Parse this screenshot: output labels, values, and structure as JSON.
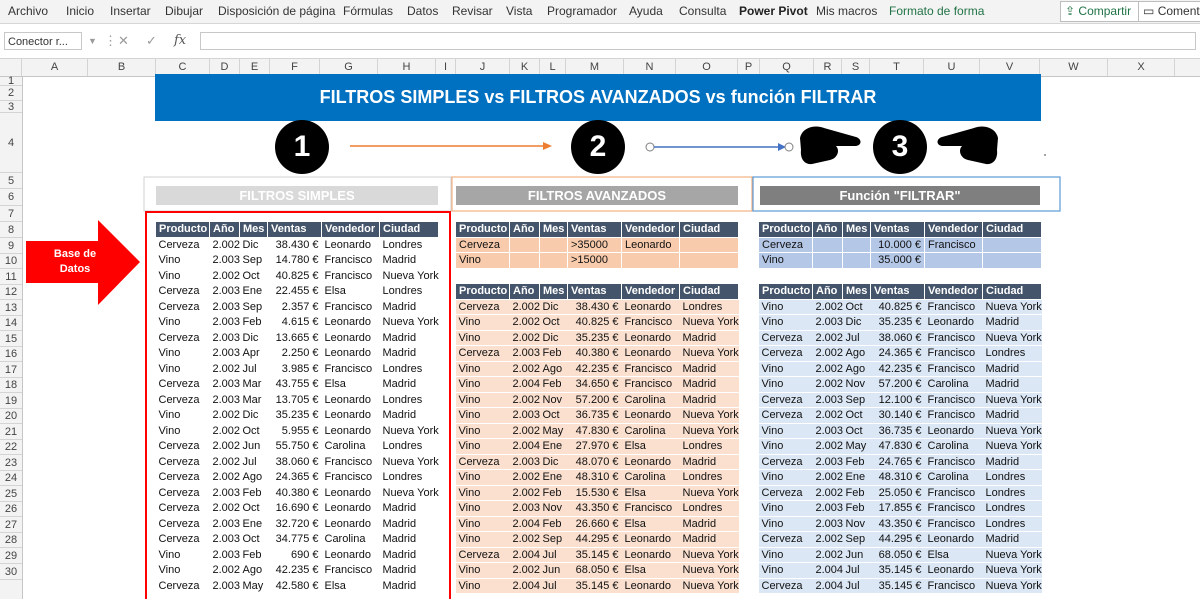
{
  "ribbon": {
    "tabs": [
      "Archivo",
      "Inicio",
      "Insertar",
      "Dibujar",
      "Disposición de página",
      "Fórmulas",
      "Datos",
      "Revisar",
      "Vista",
      "Programador",
      "Ayuda",
      "Consulta",
      "Power Pivot",
      "Mis macros",
      "Formato de forma"
    ],
    "share_label": "Compartir",
    "comments_label": "Coment"
  },
  "formula_bar": {
    "name_box": "Conector r...",
    "fx": "fx",
    "cancel": "✕",
    "enter": "✓",
    "value": ""
  },
  "columns": [
    "A",
    "B",
    "C",
    "D",
    "E",
    "F",
    "G",
    "H",
    "I",
    "J",
    "K",
    "L",
    "M",
    "N",
    "O",
    "P",
    "Q",
    "R",
    "S",
    "T",
    "U",
    "V",
    "W",
    "X"
  ],
  "rows": [
    "1",
    "2",
    "3",
    "4",
    "5",
    "6",
    "7",
    "8",
    "9",
    "10",
    "11",
    "12",
    "13",
    "14",
    "15",
    "16",
    "17",
    "18",
    "19",
    "20",
    "21",
    "22",
    "23",
    "24",
    "25",
    "26",
    "27",
    "28",
    "29",
    "30"
  ],
  "banner": "FILTROS SIMPLES vs FILTROS AVANZADOS vs función FILTRAR",
  "steps": [
    "1",
    "2",
    "3"
  ],
  "base_label": "Base de Datos",
  "sections": {
    "simple": "FILTROS SIMPLES",
    "advanced": "FILTROS AVANZADOS",
    "filtrar": "Función \"FILTRAR\""
  },
  "headers": [
    "Producto",
    "Año",
    "Mes",
    "Ventas",
    "Vendedor",
    "Ciudad"
  ],
  "table_a": [
    [
      "Cerveza",
      "2.002",
      "Dic",
      "38.430 €",
      "Leonardo",
      "Londres"
    ],
    [
      "Vino",
      "2.003",
      "Sep",
      "14.780 €",
      "Francisco",
      "Madrid"
    ],
    [
      "Vino",
      "2.002",
      "Oct",
      "40.825 €",
      "Francisco",
      "Nueva York"
    ],
    [
      "Cerveza",
      "2.003",
      "Ene",
      "22.455 €",
      "Elsa",
      "Londres"
    ],
    [
      "Cerveza",
      "2.003",
      "Sep",
      "2.357 €",
      "Francisco",
      "Madrid"
    ],
    [
      "Vino",
      "2.003",
      "Feb",
      "4.615 €",
      "Leonardo",
      "Nueva York"
    ],
    [
      "Cerveza",
      "2.003",
      "Dic",
      "13.665 €",
      "Leonardo",
      "Madrid"
    ],
    [
      "Vino",
      "2.003",
      "Apr",
      "2.250 €",
      "Leonardo",
      "Madrid"
    ],
    [
      "Vino",
      "2.002",
      "Jul",
      "3.985 €",
      "Francisco",
      "Londres"
    ],
    [
      "Cerveza",
      "2.003",
      "Mar",
      "43.755 €",
      "Elsa",
      "Madrid"
    ],
    [
      "Cerveza",
      "2.003",
      "Mar",
      "13.705 €",
      "Leonardo",
      "Londres"
    ],
    [
      "Vino",
      "2.002",
      "Dic",
      "35.235 €",
      "Leonardo",
      "Madrid"
    ],
    [
      "Vino",
      "2.002",
      "Oct",
      "5.955 €",
      "Leonardo",
      "Nueva York"
    ],
    [
      "Cerveza",
      "2.002",
      "Jun",
      "55.750 €",
      "Carolina",
      "Londres"
    ],
    [
      "Cerveza",
      "2.002",
      "Jul",
      "38.060 €",
      "Francisco",
      "Nueva York"
    ],
    [
      "Cerveza",
      "2.002",
      "Ago",
      "24.365 €",
      "Francisco",
      "Londres"
    ],
    [
      "Cerveza",
      "2.003",
      "Feb",
      "40.380 €",
      "Leonardo",
      "Nueva York"
    ],
    [
      "Cerveza",
      "2.002",
      "Oct",
      "16.690 €",
      "Leonardo",
      "Madrid"
    ],
    [
      "Cerveza",
      "2.003",
      "Ene",
      "32.720 €",
      "Leonardo",
      "Madrid"
    ],
    [
      "Cerveza",
      "2.003",
      "Oct",
      "34.775 €",
      "Carolina",
      "Madrid"
    ],
    [
      "Vino",
      "2.003",
      "Feb",
      "690 €",
      "Leonardo",
      "Madrid"
    ],
    [
      "Vino",
      "2.002",
      "Ago",
      "42.235 €",
      "Francisco",
      "Madrid"
    ],
    [
      "Cerveza",
      "2.003",
      "May",
      "42.580 €",
      "Elsa",
      "Madrid"
    ]
  ],
  "criteria_b": [
    [
      "Cerveza",
      "",
      "",
      ">35000",
      "Leonardo",
      ""
    ],
    [
      "Vino",
      "",
      "",
      ">15000",
      "",
      ""
    ]
  ],
  "table_b": [
    [
      "Cerveza",
      "2.002",
      "Dic",
      "38.430 €",
      "Leonardo",
      "Londres"
    ],
    [
      "Vino",
      "2.002",
      "Oct",
      "40.825 €",
      "Francisco",
      "Nueva York"
    ],
    [
      "Vino",
      "2.002",
      "Dic",
      "35.235 €",
      "Leonardo",
      "Madrid"
    ],
    [
      "Cerveza",
      "2.003",
      "Feb",
      "40.380 €",
      "Leonardo",
      "Nueva York"
    ],
    [
      "Vino",
      "2.002",
      "Ago",
      "42.235 €",
      "Francisco",
      "Madrid"
    ],
    [
      "Vino",
      "2.004",
      "Feb",
      "34.650 €",
      "Francisco",
      "Madrid"
    ],
    [
      "Vino",
      "2.002",
      "Nov",
      "57.200 €",
      "Carolina",
      "Madrid"
    ],
    [
      "Vino",
      "2.003",
      "Oct",
      "36.735 €",
      "Leonardo",
      "Nueva York"
    ],
    [
      "Vino",
      "2.002",
      "May",
      "47.830 €",
      "Carolina",
      "Nueva York"
    ],
    [
      "Vino",
      "2.004",
      "Ene",
      "27.970 €",
      "Elsa",
      "Londres"
    ],
    [
      "Cerveza",
      "2.003",
      "Dic",
      "48.070 €",
      "Leonardo",
      "Madrid"
    ],
    [
      "Vino",
      "2.002",
      "Ene",
      "48.310 €",
      "Carolina",
      "Londres"
    ],
    [
      "Vino",
      "2.002",
      "Feb",
      "15.530 €",
      "Elsa",
      "Nueva York"
    ],
    [
      "Vino",
      "2.003",
      "Nov",
      "43.350 €",
      "Francisco",
      "Londres"
    ],
    [
      "Vino",
      "2.004",
      "Feb",
      "26.660 €",
      "Elsa",
      "Madrid"
    ],
    [
      "Vino",
      "2.002",
      "Sep",
      "44.295 €",
      "Leonardo",
      "Madrid"
    ],
    [
      "Cerveza",
      "2.004",
      "Jul",
      "35.145 €",
      "Leonardo",
      "Nueva York"
    ],
    [
      "Vino",
      "2.002",
      "Jun",
      "68.050 €",
      "Elsa",
      "Nueva York"
    ],
    [
      "Vino",
      "2.004",
      "Jul",
      "35.145 €",
      "Leonardo",
      "Nueva York"
    ]
  ],
  "criteria_c": [
    [
      "Cerveza",
      "",
      "",
      "10.000 €",
      "Francisco",
      ""
    ],
    [
      "Vino",
      "",
      "",
      "35.000 €",
      "",
      ""
    ]
  ],
  "table_c": [
    [
      "Vino",
      "2.002",
      "Oct",
      "40.825 €",
      "Francisco",
      "Nueva York"
    ],
    [
      "Vino",
      "2.003",
      "Dic",
      "35.235 €",
      "Leonardo",
      "Madrid"
    ],
    [
      "Cerveza",
      "2.002",
      "Jul",
      "38.060 €",
      "Francisco",
      "Nueva York"
    ],
    [
      "Cerveza",
      "2.002",
      "Ago",
      "24.365 €",
      "Francisco",
      "Londres"
    ],
    [
      "Vino",
      "2.002",
      "Ago",
      "42.235 €",
      "Francisco",
      "Madrid"
    ],
    [
      "Vino",
      "2.002",
      "Nov",
      "57.200 €",
      "Carolina",
      "Madrid"
    ],
    [
      "Cerveza",
      "2.003",
      "Sep",
      "12.100 €",
      "Francisco",
      "Nueva York"
    ],
    [
      "Cerveza",
      "2.002",
      "Oct",
      "30.140 €",
      "Francisco",
      "Madrid"
    ],
    [
      "Vino",
      "2.003",
      "Oct",
      "36.735 €",
      "Leonardo",
      "Nueva York"
    ],
    [
      "Vino",
      "2.002",
      "May",
      "47.830 €",
      "Carolina",
      "Nueva York"
    ],
    [
      "Cerveza",
      "2.003",
      "Feb",
      "24.765 €",
      "Francisco",
      "Madrid"
    ],
    [
      "Vino",
      "2.002",
      "Ene",
      "48.310 €",
      "Carolina",
      "Londres"
    ],
    [
      "Cerveza",
      "2.002",
      "Feb",
      "25.050 €",
      "Francisco",
      "Londres"
    ],
    [
      "Vino",
      "2.003",
      "Feb",
      "17.855 €",
      "Francisco",
      "Londres"
    ],
    [
      "Vino",
      "2.003",
      "Nov",
      "43.350 €",
      "Francisco",
      "Londres"
    ],
    [
      "Cerveza",
      "2.002",
      "Sep",
      "44.295 €",
      "Leonardo",
      "Madrid"
    ],
    [
      "Vino",
      "2.002",
      "Jun",
      "68.050 €",
      "Elsa",
      "Nueva York"
    ],
    [
      "Vino",
      "2.004",
      "Jul",
      "35.145 €",
      "Leonardo",
      "Nueva York"
    ],
    [
      "Cerveza",
      "2.004",
      "Jul",
      "35.145 €",
      "Francisco",
      "Nueva York"
    ]
  ],
  "colors": {
    "banner": "#0070c0",
    "header": "#44546a",
    "orange_row": "#fbe0cf",
    "blue_row": "#dbe7f5",
    "red": "#ff0000"
  }
}
